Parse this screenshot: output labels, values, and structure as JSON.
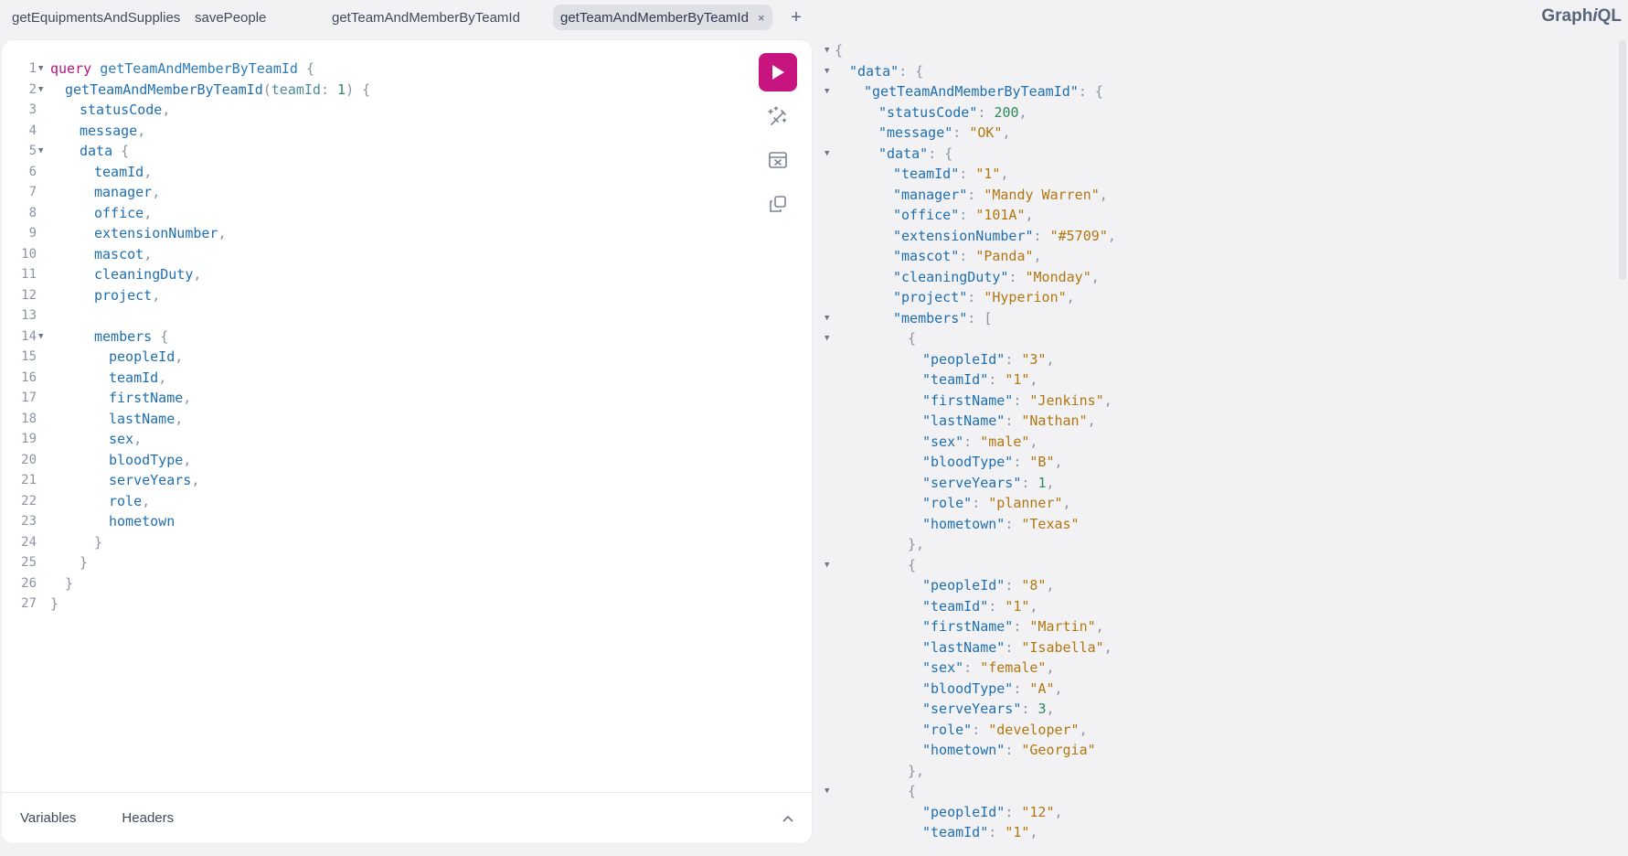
{
  "tabs": [
    {
      "label": "getEquipmentsAndSupplies",
      "active": false
    },
    {
      "label": "savePeople",
      "active": false
    },
    {
      "label": "getTeamAndMemberByTeamId",
      "active": false
    },
    {
      "label": "getTeamAndMemberByTeamId",
      "active": true
    }
  ],
  "tab_add_symbol": "+",
  "tab_close_symbol": "×",
  "logo": {
    "prefix": "Graph",
    "italic": "i",
    "suffix": "QL"
  },
  "editor": {
    "lines": [
      {
        "n": "1",
        "fold": true,
        "indent": 0,
        "tokens": [
          [
            "kw",
            "query"
          ],
          [
            "t",
            " "
          ],
          [
            "def",
            "getTeamAndMemberByTeamId"
          ],
          [
            "t",
            " "
          ],
          [
            "p",
            "{"
          ]
        ]
      },
      {
        "n": "2",
        "fold": true,
        "indent": 1,
        "tokens": [
          [
            "src",
            "getTeamAndMemberByTeamId"
          ],
          [
            "p",
            "("
          ],
          [
            "arg",
            "teamId"
          ],
          [
            "p",
            ": "
          ],
          [
            "num",
            "1"
          ],
          [
            "p",
            ") {"
          ]
        ]
      },
      {
        "n": "3",
        "fold": false,
        "indent": 2,
        "tokens": [
          [
            "src",
            "statusCode"
          ],
          [
            "p",
            ","
          ]
        ]
      },
      {
        "n": "4",
        "fold": false,
        "indent": 2,
        "tokens": [
          [
            "src",
            "message"
          ],
          [
            "p",
            ","
          ]
        ]
      },
      {
        "n": "5",
        "fold": true,
        "indent": 2,
        "tokens": [
          [
            "src",
            "data"
          ],
          [
            "p",
            " {"
          ]
        ]
      },
      {
        "n": "6",
        "fold": false,
        "indent": 3,
        "tokens": [
          [
            "src",
            "teamId"
          ],
          [
            "p",
            ","
          ]
        ]
      },
      {
        "n": "7",
        "fold": false,
        "indent": 3,
        "tokens": [
          [
            "src",
            "manager"
          ],
          [
            "p",
            ","
          ]
        ]
      },
      {
        "n": "8",
        "fold": false,
        "indent": 3,
        "tokens": [
          [
            "src",
            "office"
          ],
          [
            "p",
            ","
          ]
        ]
      },
      {
        "n": "9",
        "fold": false,
        "indent": 3,
        "tokens": [
          [
            "src",
            "extensionNumber"
          ],
          [
            "p",
            ","
          ]
        ]
      },
      {
        "n": "10",
        "fold": false,
        "indent": 3,
        "tokens": [
          [
            "src",
            "mascot"
          ],
          [
            "p",
            ","
          ]
        ]
      },
      {
        "n": "11",
        "fold": false,
        "indent": 3,
        "tokens": [
          [
            "src",
            "cleaningDuty"
          ],
          [
            "p",
            ","
          ]
        ]
      },
      {
        "n": "12",
        "fold": false,
        "indent": 3,
        "tokens": [
          [
            "src",
            "project"
          ],
          [
            "p",
            ","
          ]
        ]
      },
      {
        "n": "13",
        "fold": false,
        "indent": 0,
        "tokens": []
      },
      {
        "n": "14",
        "fold": true,
        "indent": 3,
        "tokens": [
          [
            "src",
            "members"
          ],
          [
            "p",
            " {"
          ]
        ]
      },
      {
        "n": "15",
        "fold": false,
        "indent": 4,
        "tokens": [
          [
            "src",
            "peopleId"
          ],
          [
            "p",
            ","
          ]
        ]
      },
      {
        "n": "16",
        "fold": false,
        "indent": 4,
        "tokens": [
          [
            "src",
            "teamId"
          ],
          [
            "p",
            ","
          ]
        ]
      },
      {
        "n": "17",
        "fold": false,
        "indent": 4,
        "tokens": [
          [
            "src",
            "firstName"
          ],
          [
            "p",
            ","
          ]
        ]
      },
      {
        "n": "18",
        "fold": false,
        "indent": 4,
        "tokens": [
          [
            "src",
            "lastName"
          ],
          [
            "p",
            ","
          ]
        ]
      },
      {
        "n": "19",
        "fold": false,
        "indent": 4,
        "tokens": [
          [
            "src",
            "sex"
          ],
          [
            "p",
            ","
          ]
        ]
      },
      {
        "n": "20",
        "fold": false,
        "indent": 4,
        "tokens": [
          [
            "src",
            "bloodType"
          ],
          [
            "p",
            ","
          ]
        ]
      },
      {
        "n": "21",
        "fold": false,
        "indent": 4,
        "tokens": [
          [
            "src",
            "serveYears"
          ],
          [
            "p",
            ","
          ]
        ]
      },
      {
        "n": "22",
        "fold": false,
        "indent": 4,
        "tokens": [
          [
            "src",
            "role"
          ],
          [
            "p",
            ","
          ]
        ]
      },
      {
        "n": "23",
        "fold": false,
        "indent": 4,
        "tokens": [
          [
            "src",
            "hometown"
          ]
        ]
      },
      {
        "n": "24",
        "fold": false,
        "indent": 3,
        "tokens": [
          [
            "p",
            "}"
          ]
        ]
      },
      {
        "n": "25",
        "fold": false,
        "indent": 2,
        "tokens": [
          [
            "p",
            "}"
          ]
        ]
      },
      {
        "n": "26",
        "fold": false,
        "indent": 1,
        "tokens": [
          [
            "p",
            "}"
          ]
        ]
      },
      {
        "n": "27",
        "fold": false,
        "indent": 0,
        "tokens": [
          [
            "p",
            "}"
          ]
        ]
      }
    ]
  },
  "bottom_tabs": [
    {
      "label": "Variables"
    },
    {
      "label": "Headers"
    }
  ],
  "result": {
    "lines": [
      {
        "fold": true,
        "indent": 0,
        "tokens": [
          [
            "p",
            "{"
          ]
        ]
      },
      {
        "fold": true,
        "indent": 1,
        "tokens": [
          [
            "k",
            "\"data\""
          ],
          [
            "p",
            ": {"
          ]
        ]
      },
      {
        "fold": true,
        "indent": 2,
        "tokens": [
          [
            "k",
            "\"getTeamAndMemberByTeamId\""
          ],
          [
            "p",
            ": {"
          ]
        ]
      },
      {
        "fold": false,
        "indent": 3,
        "tokens": [
          [
            "k",
            "\"statusCode\""
          ],
          [
            "p",
            ": "
          ],
          [
            "n",
            "200"
          ],
          [
            "p",
            ","
          ]
        ]
      },
      {
        "fold": false,
        "indent": 3,
        "tokens": [
          [
            "k",
            "\"message\""
          ],
          [
            "p",
            ": "
          ],
          [
            "s",
            "\"OK\""
          ],
          [
            "p",
            ","
          ]
        ]
      },
      {
        "fold": true,
        "indent": 3,
        "tokens": [
          [
            "k",
            "\"data\""
          ],
          [
            "p",
            ": {"
          ]
        ]
      },
      {
        "fold": false,
        "indent": 4,
        "tokens": [
          [
            "k",
            "\"teamId\""
          ],
          [
            "p",
            ": "
          ],
          [
            "s",
            "\"1\""
          ],
          [
            "p",
            ","
          ]
        ]
      },
      {
        "fold": false,
        "indent": 4,
        "tokens": [
          [
            "k",
            "\"manager\""
          ],
          [
            "p",
            ": "
          ],
          [
            "s",
            "\"Mandy Warren\""
          ],
          [
            "p",
            ","
          ]
        ]
      },
      {
        "fold": false,
        "indent": 4,
        "tokens": [
          [
            "k",
            "\"office\""
          ],
          [
            "p",
            ": "
          ],
          [
            "s",
            "\"101A\""
          ],
          [
            "p",
            ","
          ]
        ]
      },
      {
        "fold": false,
        "indent": 4,
        "tokens": [
          [
            "k",
            "\"extensionNumber\""
          ],
          [
            "p",
            ": "
          ],
          [
            "s",
            "\"#5709\""
          ],
          [
            "p",
            ","
          ]
        ]
      },
      {
        "fold": false,
        "indent": 4,
        "tokens": [
          [
            "k",
            "\"mascot\""
          ],
          [
            "p",
            ": "
          ],
          [
            "s",
            "\"Panda\""
          ],
          [
            "p",
            ","
          ]
        ]
      },
      {
        "fold": false,
        "indent": 4,
        "tokens": [
          [
            "k",
            "\"cleaningDuty\""
          ],
          [
            "p",
            ": "
          ],
          [
            "s",
            "\"Monday\""
          ],
          [
            "p",
            ","
          ]
        ]
      },
      {
        "fold": false,
        "indent": 4,
        "tokens": [
          [
            "k",
            "\"project\""
          ],
          [
            "p",
            ": "
          ],
          [
            "s",
            "\"Hyperion\""
          ],
          [
            "p",
            ","
          ]
        ]
      },
      {
        "fold": true,
        "indent": 4,
        "tokens": [
          [
            "k",
            "\"members\""
          ],
          [
            "p",
            ": ["
          ]
        ]
      },
      {
        "fold": true,
        "indent": 5,
        "tokens": [
          [
            "p",
            "{"
          ]
        ]
      },
      {
        "fold": false,
        "indent": 6,
        "tokens": [
          [
            "k",
            "\"peopleId\""
          ],
          [
            "p",
            ": "
          ],
          [
            "s",
            "\"3\""
          ],
          [
            "p",
            ","
          ]
        ]
      },
      {
        "fold": false,
        "indent": 6,
        "tokens": [
          [
            "k",
            "\"teamId\""
          ],
          [
            "p",
            ": "
          ],
          [
            "s",
            "\"1\""
          ],
          [
            "p",
            ","
          ]
        ]
      },
      {
        "fold": false,
        "indent": 6,
        "tokens": [
          [
            "k",
            "\"firstName\""
          ],
          [
            "p",
            ": "
          ],
          [
            "s",
            "\"Jenkins\""
          ],
          [
            "p",
            ","
          ]
        ]
      },
      {
        "fold": false,
        "indent": 6,
        "tokens": [
          [
            "k",
            "\"lastName\""
          ],
          [
            "p",
            ": "
          ],
          [
            "s",
            "\"Nathan\""
          ],
          [
            "p",
            ","
          ]
        ]
      },
      {
        "fold": false,
        "indent": 6,
        "tokens": [
          [
            "k",
            "\"sex\""
          ],
          [
            "p",
            ": "
          ],
          [
            "s",
            "\"male\""
          ],
          [
            "p",
            ","
          ]
        ]
      },
      {
        "fold": false,
        "indent": 6,
        "tokens": [
          [
            "k",
            "\"bloodType\""
          ],
          [
            "p",
            ": "
          ],
          [
            "s",
            "\"B\""
          ],
          [
            "p",
            ","
          ]
        ]
      },
      {
        "fold": false,
        "indent": 6,
        "tokens": [
          [
            "k",
            "\"serveYears\""
          ],
          [
            "p",
            ": "
          ],
          [
            "n",
            "1"
          ],
          [
            "p",
            ","
          ]
        ]
      },
      {
        "fold": false,
        "indent": 6,
        "tokens": [
          [
            "k",
            "\"role\""
          ],
          [
            "p",
            ": "
          ],
          [
            "s",
            "\"planner\""
          ],
          [
            "p",
            ","
          ]
        ]
      },
      {
        "fold": false,
        "indent": 6,
        "tokens": [
          [
            "k",
            "\"hometown\""
          ],
          [
            "p",
            ": "
          ],
          [
            "s",
            "\"Texas\""
          ]
        ]
      },
      {
        "fold": false,
        "indent": 5,
        "tokens": [
          [
            "p",
            "},"
          ]
        ]
      },
      {
        "fold": true,
        "indent": 5,
        "tokens": [
          [
            "p",
            "{"
          ]
        ]
      },
      {
        "fold": false,
        "indent": 6,
        "tokens": [
          [
            "k",
            "\"peopleId\""
          ],
          [
            "p",
            ": "
          ],
          [
            "s",
            "\"8\""
          ],
          [
            "p",
            ","
          ]
        ]
      },
      {
        "fold": false,
        "indent": 6,
        "tokens": [
          [
            "k",
            "\"teamId\""
          ],
          [
            "p",
            ": "
          ],
          [
            "s",
            "\"1\""
          ],
          [
            "p",
            ","
          ]
        ]
      },
      {
        "fold": false,
        "indent": 6,
        "tokens": [
          [
            "k",
            "\"firstName\""
          ],
          [
            "p",
            ": "
          ],
          [
            "s",
            "\"Martin\""
          ],
          [
            "p",
            ","
          ]
        ]
      },
      {
        "fold": false,
        "indent": 6,
        "tokens": [
          [
            "k",
            "\"lastName\""
          ],
          [
            "p",
            ": "
          ],
          [
            "s",
            "\"Isabella\""
          ],
          [
            "p",
            ","
          ]
        ]
      },
      {
        "fold": false,
        "indent": 6,
        "tokens": [
          [
            "k",
            "\"sex\""
          ],
          [
            "p",
            ": "
          ],
          [
            "s",
            "\"female\""
          ],
          [
            "p",
            ","
          ]
        ]
      },
      {
        "fold": false,
        "indent": 6,
        "tokens": [
          [
            "k",
            "\"bloodType\""
          ],
          [
            "p",
            ": "
          ],
          [
            "s",
            "\"A\""
          ],
          [
            "p",
            ","
          ]
        ]
      },
      {
        "fold": false,
        "indent": 6,
        "tokens": [
          [
            "k",
            "\"serveYears\""
          ],
          [
            "p",
            ": "
          ],
          [
            "n",
            "3"
          ],
          [
            "p",
            ","
          ]
        ]
      },
      {
        "fold": false,
        "indent": 6,
        "tokens": [
          [
            "k",
            "\"role\""
          ],
          [
            "p",
            ": "
          ],
          [
            "s",
            "\"developer\""
          ],
          [
            "p",
            ","
          ]
        ]
      },
      {
        "fold": false,
        "indent": 6,
        "tokens": [
          [
            "k",
            "\"hometown\""
          ],
          [
            "p",
            ": "
          ],
          [
            "s",
            "\"Georgia\""
          ]
        ]
      },
      {
        "fold": false,
        "indent": 5,
        "tokens": [
          [
            "p",
            "},"
          ]
        ]
      },
      {
        "fold": true,
        "indent": 5,
        "tokens": [
          [
            "p",
            "{"
          ]
        ]
      },
      {
        "fold": false,
        "indent": 6,
        "tokens": [
          [
            "k",
            "\"peopleId\""
          ],
          [
            "p",
            ": "
          ],
          [
            "s",
            "\"12\""
          ],
          [
            "p",
            ","
          ]
        ]
      },
      {
        "fold": false,
        "indent": 6,
        "tokens": [
          [
            "k",
            "\"teamId\""
          ],
          [
            "p",
            ": "
          ],
          [
            "s",
            "\"1\""
          ],
          [
            "p",
            ","
          ]
        ]
      }
    ]
  },
  "icons": {
    "run": "play-icon",
    "prettify": "magic-wand-icon",
    "merge": "merge-fragments-icon",
    "copy": "copy-icon",
    "collapse": "chevron-up-icon",
    "fold": "fold-triangle-icon"
  },
  "colors": {
    "accent": "#c7147f",
    "keyword": "#b5147f",
    "field": "#1f6fb0",
    "string": "#b1760f",
    "number": "#2c8a5f"
  }
}
